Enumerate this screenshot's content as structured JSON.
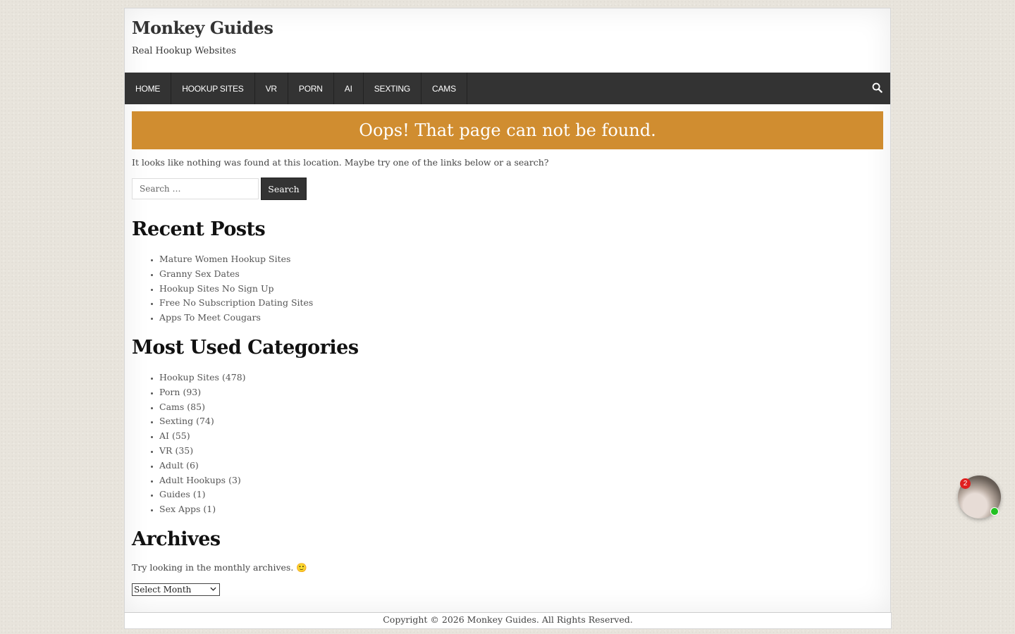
{
  "site": {
    "title": "Monkey Guides",
    "description": "Real Hookup Websites"
  },
  "nav": {
    "items": [
      "HOME",
      "HOOKUP SITES",
      "VR",
      "PORN",
      "AI",
      "SEXTING",
      "CAMS"
    ]
  },
  "banner": {
    "title": "Oops! That page can not be found."
  },
  "content": {
    "intro": "It looks like nothing was found at this location. Maybe try one of the links below or a search?",
    "search": {
      "placeholder": "Search …",
      "button_label": "Search"
    },
    "recent_posts": {
      "title": "Recent Posts",
      "items": [
        "Mature Women Hookup Sites",
        "Granny Sex Dates",
        "Hookup Sites No Sign Up",
        "Free No Subscription Dating Sites",
        "Apps To Meet Cougars"
      ]
    },
    "categories": {
      "title": "Most Used Categories",
      "items": [
        {
          "name": "Hookup Sites",
          "count": "(478)"
        },
        {
          "name": "Porn",
          "count": "(93)"
        },
        {
          "name": "Cams",
          "count": "(85)"
        },
        {
          "name": "Sexting",
          "count": "(74)"
        },
        {
          "name": "AI",
          "count": "(55)"
        },
        {
          "name": "VR",
          "count": "(35)"
        },
        {
          "name": "Adult",
          "count": "(6)"
        },
        {
          "name": "Adult Hookups",
          "count": "(3)"
        },
        {
          "name": "Guides",
          "count": "(1)"
        },
        {
          "name": "Sex Apps",
          "count": "(1)"
        }
      ]
    },
    "archives": {
      "title": "Archives",
      "text": "Try looking in the monthly archives. 🙂",
      "select_value": "Select Month"
    }
  },
  "footer": {
    "copyright": "Copyright © 2026 Monkey Guides. All Rights Reserved."
  },
  "chat_widget": {
    "badge_count": "2"
  }
}
